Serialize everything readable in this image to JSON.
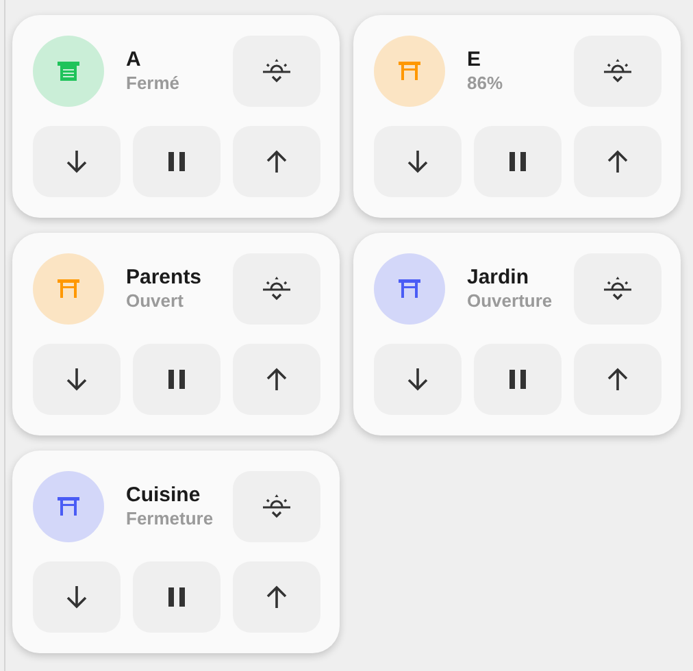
{
  "covers": [
    {
      "name": "A",
      "state": "Fermé",
      "kind": "garage",
      "color": "#1fc35a"
    },
    {
      "name": "E",
      "state": "86%",
      "kind": "awning",
      "color": "#ff9800"
    },
    {
      "name": "Parents",
      "state": "Ouvert",
      "kind": "awning",
      "color": "#ff9800"
    },
    {
      "name": "Jardin",
      "state": "Ouverture",
      "kind": "awning",
      "color": "#4a5cf5"
    },
    {
      "name": "Cuisine",
      "state": "Fermeture",
      "kind": "awning",
      "color": "#4a5cf5"
    }
  ]
}
